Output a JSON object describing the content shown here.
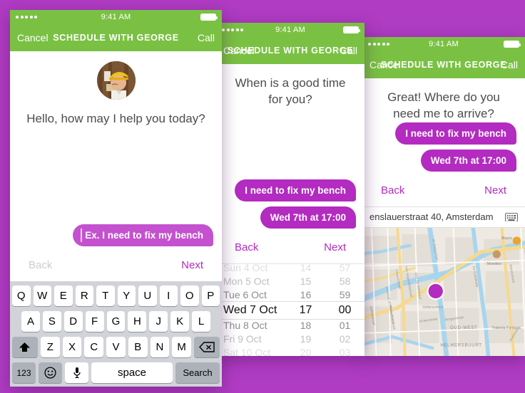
{
  "background_color": "#b03cc4",
  "brand": {
    "green": "#7ac143",
    "purple": "#b32bc0",
    "purple_light": "#c451cf"
  },
  "phones": [
    {
      "id": "phone-1",
      "status_bar": {
        "time": "9:41 AM",
        "signal_dots": 5,
        "battery_icon": "battery-full-icon"
      },
      "nav": {
        "left_label": "Cancel",
        "title": "SCHEDULE WITH GEORGE",
        "right_label": "Call"
      },
      "avatar": {
        "name": "george-avatar",
        "alt": "construction worker with yellow hard hat"
      },
      "prompt": "Hello, how may I help you today?",
      "bubbles": [
        {
          "text": "Ex. I need to fix my bench",
          "is_placeholder": true
        }
      ],
      "actions": {
        "back": "Back",
        "back_disabled": true,
        "next": "Next"
      },
      "keyboard": {
        "row1": [
          "Q",
          "W",
          "E",
          "R",
          "T",
          "Y",
          "U",
          "I",
          "O",
          "P"
        ],
        "row2": [
          "A",
          "S",
          "D",
          "F",
          "G",
          "H",
          "J",
          "K",
          "L"
        ],
        "row3_shift": "shift-icon",
        "row3": [
          "Z",
          "X",
          "C",
          "V",
          "B",
          "N",
          "M"
        ],
        "row3_backspace": "backspace-icon",
        "numbers_key": "123",
        "emoji_key": "emoji-icon",
        "mic_key": "microphone-icon",
        "space_key": "space",
        "action_key": "Search"
      }
    },
    {
      "id": "phone-2",
      "status_bar": {
        "time": "9:41 AM",
        "signal_dots": 5,
        "battery_icon": "battery-full-icon"
      },
      "nav": {
        "left_label": "Cancel",
        "title": "SCHEDULE WITH GEORGE",
        "right_label": "Call"
      },
      "prompt": "When is a good time for you?",
      "bubbles": [
        {
          "text": "I need to fix my bench",
          "is_placeholder": false
        },
        {
          "text": "Wed 7th at 17:00",
          "is_placeholder": false
        }
      ],
      "actions": {
        "back": "Back",
        "back_disabled": false,
        "next": "Next"
      },
      "picker": {
        "days": [
          "Sun 4 Oct",
          "Mon 5 Oct",
          "Tue 6 Oct",
          "Wed 7 Oct",
          "Thu 8 Oct",
          "Fri 9 Oct",
          "Sat 10 Oct"
        ],
        "hours": [
          "14",
          "15",
          "16",
          "17",
          "18",
          "19",
          "20"
        ],
        "minutes": [
          "57",
          "58",
          "59",
          "00",
          "01",
          "02",
          "03"
        ],
        "selected_index": 3,
        "selected_day": "Wed 7 Oct",
        "selected_hour": "17",
        "selected_minute": "00"
      }
    },
    {
      "id": "phone-3",
      "status_bar": {
        "time": "9:41 AM",
        "signal_dots": 5,
        "battery_icon": "battery-full-icon"
      },
      "nav": {
        "left_label": "Cancel",
        "title": "SCHEDULE WITH GEORGE",
        "right_label": "Call"
      },
      "prompt": "Great! Where do you need me to arrive?",
      "bubbles": [
        {
          "text": "I need to fix my bench",
          "is_placeholder": false
        },
        {
          "text": "Wed 7th at 17:00",
          "is_placeholder": false
        }
      ],
      "actions": {
        "back": "Back",
        "back_disabled": false,
        "next": "Next"
      },
      "address": {
        "value": "enslauerstraat 40, Amsterdam",
        "keyboard_icon": "keyboard-icon"
      },
      "map": {
        "pin_color": "#b32bc0",
        "labels": [
          "de Zwijgerlaan",
          "Van Hogendorpstraat",
          "Wim De Wittstraat",
          "Admiraal de Ruijtersracht",
          "Hofwerstraat",
          "Marco Polostraat",
          "Chasséstraat",
          "Bellamystraat",
          "Kinkerstraat",
          "Borgerstraat",
          "OUD-WEST",
          "HELMERSBUURT",
          "Da Costakade",
          "Nassaukade",
          "Marnixstraat",
          "Lauriergracht",
          "Mazzo",
          "Moeders",
          "Trattoria Fantasia"
        ]
      }
    }
  ]
}
